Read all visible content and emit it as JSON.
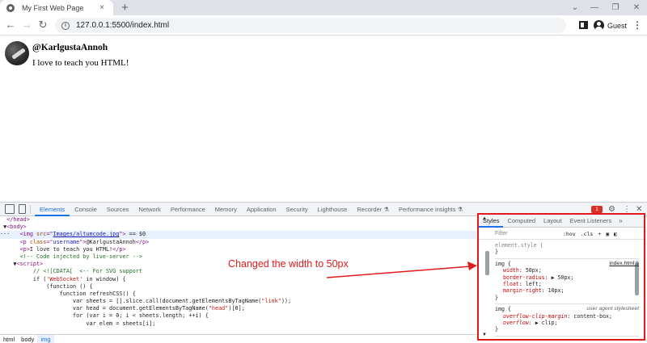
{
  "browser": {
    "tab_title": "My First Web Page",
    "tab_close": "×",
    "new_tab": "+",
    "window_controls": [
      "⌄",
      "—",
      "❐",
      "✕"
    ],
    "url": "127.0.0.1:5500/index.html",
    "profile_name": "Guest",
    "icons": {
      "favicon": "globe-icon",
      "back": "back-arrow-icon",
      "forward": "forward-arrow-icon",
      "reload": "reload-icon",
      "site_info": "info-icon",
      "side_panel": "side-panel-icon",
      "menu": "kebab-menu-icon"
    }
  },
  "page": {
    "username": "@KarlgustaAnnoh",
    "paragraph": "I love to teach you HTML!"
  },
  "devtools": {
    "tabs": [
      "Elements",
      "Console",
      "Sources",
      "Network",
      "Performance",
      "Memory",
      "Application",
      "Security",
      "Lighthouse",
      "Recorder ⚗",
      "Performance insights ⚗"
    ],
    "active_tab": "Elements",
    "error_count": "1",
    "code_lines": [
      {
        "indent": "  ",
        "parts": [
          [
            "c-key",
            "</head>"
          ]
        ]
      },
      {
        "indent": " ▼",
        "parts": [
          [
            "c-key",
            "<body>"
          ]
        ]
      },
      {
        "indent": "···   ",
        "selected": true,
        "parts": [
          [
            "c-key",
            "<img "
          ],
          [
            "c-attr",
            "src"
          ],
          [
            "c-key",
            "=\""
          ],
          [
            "c-link",
            "Images/altumcode.jpg"
          ],
          [
            "c-key",
            "\">"
          ],
          [
            "c-default",
            " == $0"
          ]
        ]
      },
      {
        "indent": "      ",
        "parts": [
          [
            "c-key",
            "<p "
          ],
          [
            "c-attr",
            "class"
          ],
          [
            "c-key",
            "=\""
          ],
          [
            "c-val",
            "username"
          ],
          [
            "c-key",
            "\">"
          ],
          [
            "c-default",
            "@KarlgustaAnnoh"
          ],
          [
            "c-key",
            "</p>"
          ]
        ]
      },
      {
        "indent": "      ",
        "parts": [
          [
            "c-key",
            "<p>"
          ],
          [
            "c-default",
            "I love to teach you HTML!"
          ],
          [
            "c-key",
            "</p>"
          ]
        ]
      },
      {
        "indent": "      ",
        "parts": [
          [
            "c-comment",
            "<!-- Code injected by live-server -->"
          ]
        ]
      },
      {
        "indent": "    ▼",
        "parts": [
          [
            "c-key",
            "<script>"
          ]
        ]
      },
      {
        "indent": "          ",
        "parts": [
          [
            "c-comment",
            "// <![CDATA[  <-- For SVG support"
          ]
        ]
      },
      {
        "indent": "          ",
        "parts": [
          [
            "c-js",
            "if ("
          ],
          [
            "c-str",
            "'WebSocket'"
          ],
          [
            "c-js",
            " in window) {"
          ]
        ]
      },
      {
        "indent": "              ",
        "parts": [
          [
            "c-js",
            "(function () {"
          ]
        ]
      },
      {
        "indent": "                  ",
        "parts": [
          [
            "c-js",
            "function refreshCSS() {"
          ]
        ]
      },
      {
        "indent": "                      ",
        "parts": [
          [
            "c-js",
            "var sheets = [].slice.call(document.getElementsByTagName("
          ],
          [
            "c-str",
            "\"link\""
          ],
          [
            "c-js",
            "));"
          ]
        ]
      },
      {
        "indent": "                      ",
        "parts": [
          [
            "c-js",
            "var head = document.getElementsByTagName("
          ],
          [
            "c-str",
            "\"head\""
          ],
          [
            "c-js",
            ")[0];"
          ]
        ]
      },
      {
        "indent": "                      ",
        "parts": [
          [
            "c-js",
            "for (var i = 0; i < sheets.length; ++i) {"
          ]
        ]
      },
      {
        "indent": "                          ",
        "parts": [
          [
            "c-js",
            "var elem = sheets[i];"
          ]
        ]
      }
    ],
    "breadcrumbs": [
      "html",
      "body",
      "img"
    ],
    "annotation": "Changed the width to 50px"
  },
  "styles": {
    "tabs": [
      "Styles",
      "Computed",
      "Layout",
      "Event Listeners"
    ],
    "active_tab": "Styles",
    "more": "»",
    "filter_placeholder": "Filter",
    "tools": [
      ":hov",
      ".cls",
      "+"
    ],
    "rules": [
      {
        "selector": "element.style {",
        "source": "",
        "muted": true,
        "decls": [],
        "close": "}"
      },
      {
        "selector": "img {",
        "source": "index.html:6",
        "decls": [
          [
            "width",
            "50px;"
          ],
          [
            "border-radius",
            "▶ 50px;"
          ],
          [
            "float",
            "left;"
          ],
          [
            "margin-right",
            "10px;"
          ]
        ],
        "close": "}"
      },
      {
        "selector": "img {",
        "source": "user agent stylesheet",
        "ua": true,
        "decls": [
          [
            "overflow-clip-margin",
            "content-box;"
          ],
          [
            "overflow",
            "▶ clip;"
          ]
        ],
        "close": "}"
      }
    ]
  },
  "colors": {
    "annotation_red": "#e01b1b",
    "devtools_blue": "#1a73e8"
  }
}
